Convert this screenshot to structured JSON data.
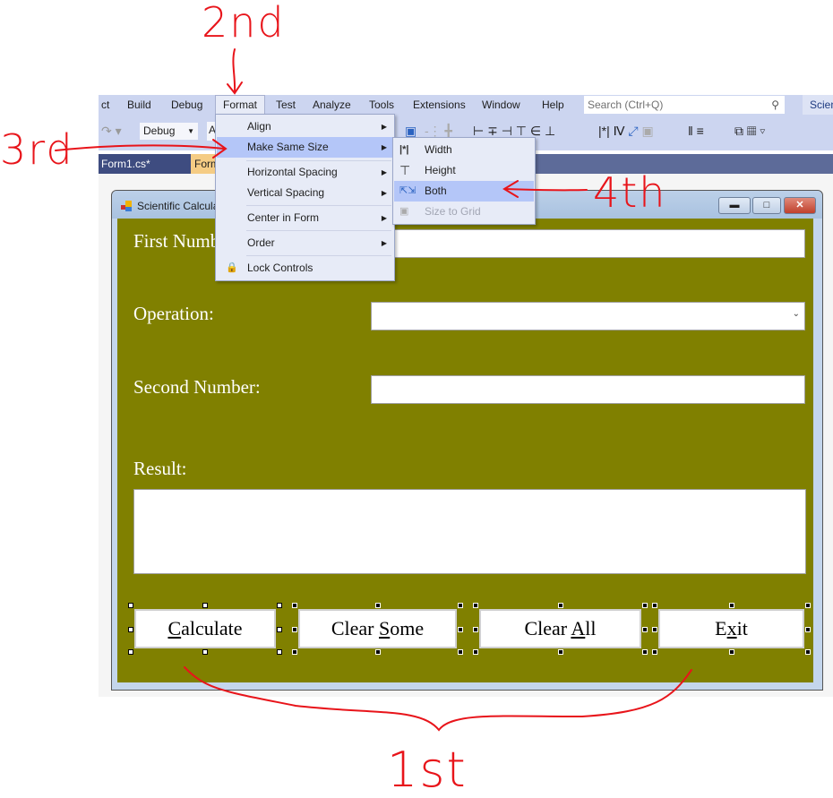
{
  "menubar": {
    "items": [
      "ct",
      "Build",
      "Debug",
      "Format",
      "Test",
      "Analyze",
      "Tools",
      "Extensions",
      "Window",
      "Help"
    ],
    "active": "Format",
    "search_placeholder": "Search (Ctrl+Q)",
    "solution_name": "Scien"
  },
  "toolbar": {
    "config": "Debug",
    "platform": "A"
  },
  "tabs": [
    {
      "label": "Form1.cs*"
    },
    {
      "label": "Form1.cs [Design]*"
    }
  ],
  "form": {
    "title": "Scientific Calculator",
    "background": "#808000",
    "labels": {
      "first": "First Number:",
      "operation": "Operation:",
      "second": "Second Number:",
      "result": "Result:"
    },
    "buttons": [
      {
        "label": "Calculate",
        "mnemonic": "C"
      },
      {
        "label": "Clear Some",
        "mnemonic": "S"
      },
      {
        "label": "Clear All",
        "mnemonic": "A"
      },
      {
        "label": "Exit",
        "mnemonic": "x"
      }
    ]
  },
  "format_menu": {
    "items": [
      {
        "label": "Align",
        "submenu": true
      },
      {
        "label": "Make Same Size",
        "submenu": true,
        "highlighted": true
      },
      {
        "label": "Horizontal Spacing",
        "submenu": true
      },
      {
        "label": "Vertical Spacing",
        "submenu": true
      },
      {
        "label": "Center in Form",
        "submenu": true
      },
      {
        "label": "Order",
        "submenu": true
      },
      {
        "label": "Lock Controls",
        "icon": "lock-icon"
      }
    ]
  },
  "make_same_size_submenu": {
    "items": [
      {
        "label": "Width",
        "icon": "same-width-icon"
      },
      {
        "label": "Height",
        "icon": "same-height-icon"
      },
      {
        "label": "Both",
        "icon": "same-size-icon",
        "highlighted": true
      },
      {
        "label": "Size to Grid",
        "icon": "size-to-grid-icon",
        "disabled": true
      }
    ]
  },
  "annotations": {
    "step1": "1st",
    "step2": "2nd",
    "step3": "3rd",
    "step4": "4th",
    "color": "#e8141a"
  }
}
